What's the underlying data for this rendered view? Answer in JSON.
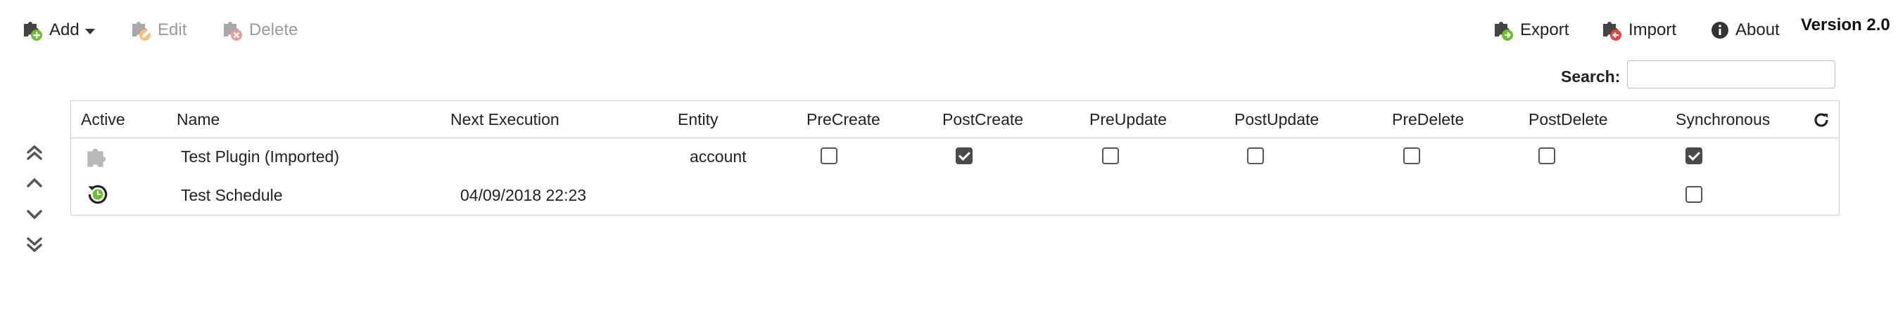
{
  "toolbar": {
    "add_label": "Add",
    "edit_label": "Edit",
    "delete_label": "Delete",
    "export_label": "Export",
    "import_label": "Import",
    "about_label": "About",
    "version": "Version 2.0"
  },
  "search": {
    "label": "Search:",
    "value": "",
    "placeholder": ""
  },
  "table": {
    "columns": [
      "Active",
      "Name",
      "Next Execution",
      "Entity",
      "PreCreate",
      "PostCreate",
      "PreUpdate",
      "PostUpdate",
      "PreDelete",
      "PostDelete",
      "Synchronous"
    ],
    "rows": [
      {
        "icon": "puzzle-piece-icon",
        "name": "Test Plugin (Imported)",
        "next_execution": "",
        "entity": "account",
        "precreate": false,
        "postcreate": true,
        "preupdate": false,
        "postupdate": false,
        "predelete": false,
        "postdelete": false,
        "synchronous": true
      },
      {
        "icon": "schedule-clock-icon",
        "name": "Test Schedule",
        "next_execution": "04/09/2018 22:23",
        "entity": "",
        "synchronous": false
      }
    ]
  },
  "colors": {
    "accent_green": "#6bbf2a",
    "accent_red": "#e0483e",
    "accent_orange": "#f2a63b",
    "icon_dark": "#444444",
    "disabled": "#9a9a9a",
    "border": "#cfcfcf"
  }
}
